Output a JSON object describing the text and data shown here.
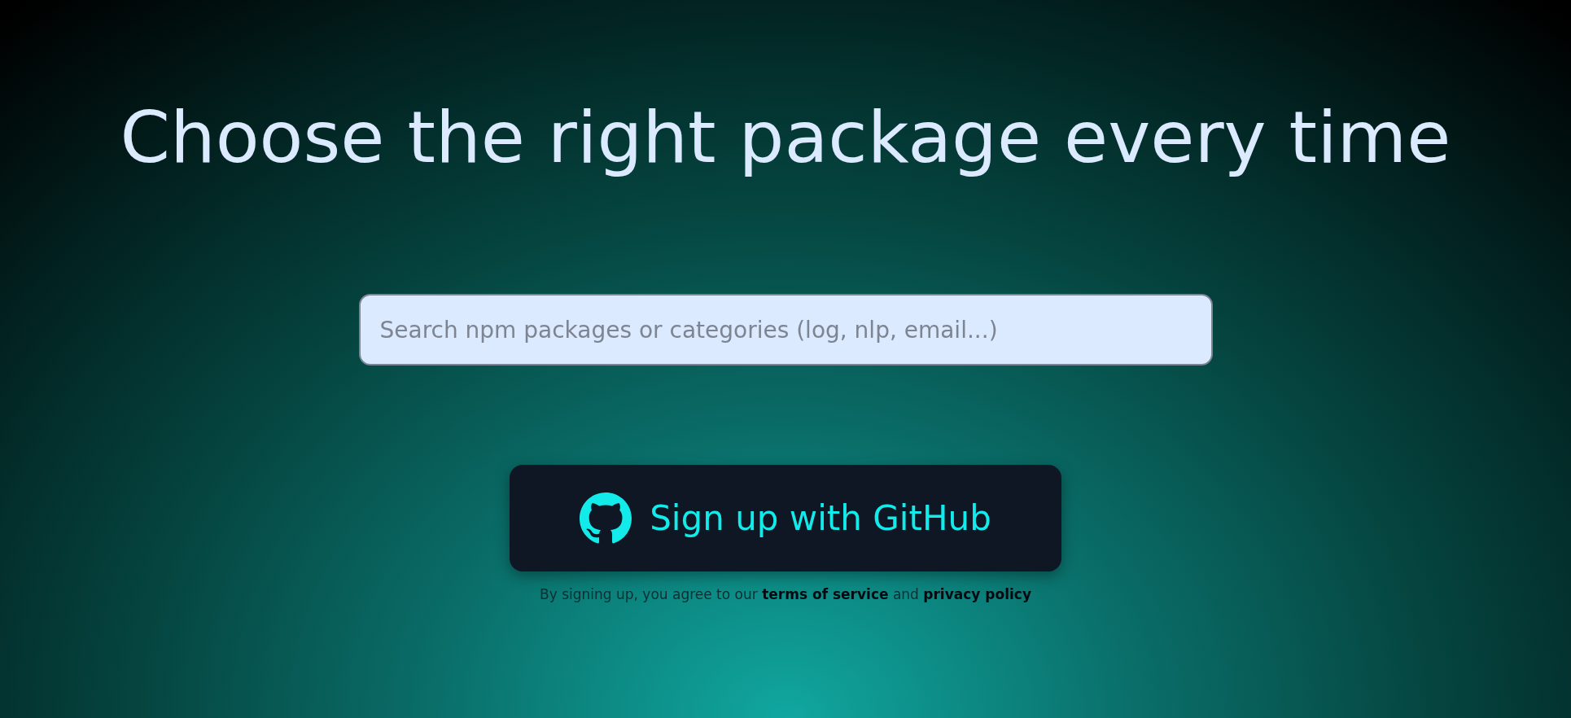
{
  "heading": "Choose the right package every time",
  "search": {
    "placeholder": "Search npm packages or categories (log, nlp, email...)"
  },
  "signup_button": {
    "label": "Sign up with GitHub"
  },
  "legal": {
    "text": "By signing up, you agree to our",
    "links": [
      {
        "label": "terms of service"
      },
      {
        "label": "privacy policy"
      }
    ],
    "joiner": "and"
  }
}
